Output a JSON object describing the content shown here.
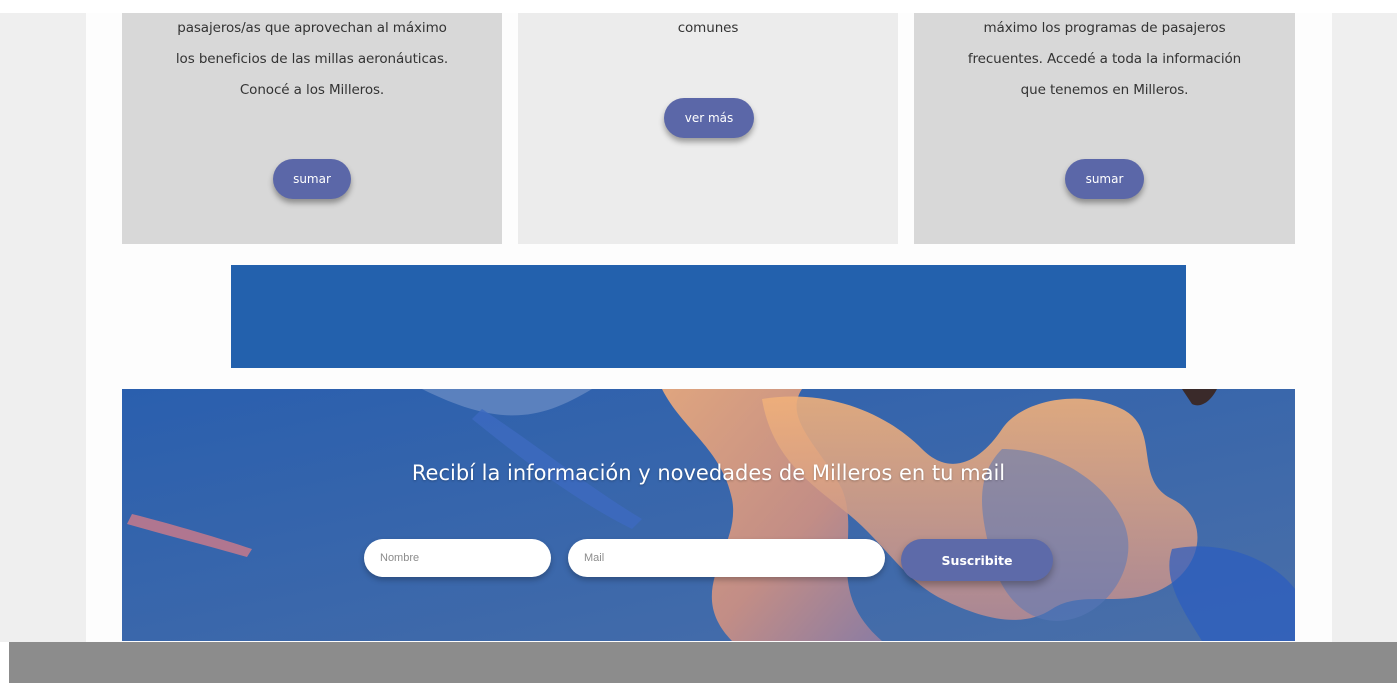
{
  "cards": [
    {
      "lines": [
        "pasajeros/as que aprovechan al máximo",
        "los beneficios de las millas aeronáuticas.",
        "Conocé a los Milleros."
      ],
      "button_label": "sumar"
    },
    {
      "lines": [
        "comunes"
      ],
      "button_label": "ver más"
    },
    {
      "lines": [
        "máximo los programas de pasajeros",
        "frecuentes. Accedé a toda la información",
        "que tenemos en Milleros."
      ],
      "button_label": "sumar"
    }
  ],
  "newsletter": {
    "title": "Recibí la información y novedades de Milleros en tu mail",
    "name_placeholder": "Nombre",
    "mail_placeholder": "Mail",
    "submit_label": "Suscribite"
  },
  "colors": {
    "button": "#5b67a8",
    "banner": "#2361ad",
    "newsletter_bg": "#3b63a0",
    "bottom_bar": "#8c8c8c"
  }
}
